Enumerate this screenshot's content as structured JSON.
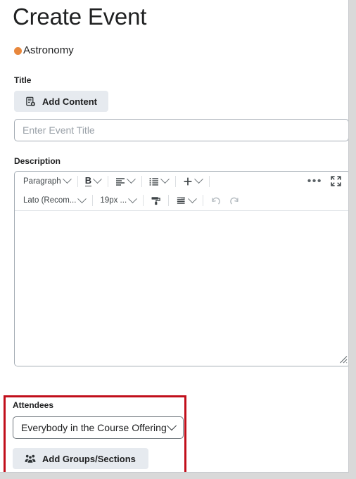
{
  "page": {
    "title": "Create Event"
  },
  "course": {
    "name": "Astronomy",
    "dot_color": "#e8873c",
    "dot_icon": "course-color-dot"
  },
  "title_field": {
    "label": "Title",
    "add_content_label": "Add Content",
    "add_content_icon": "add-content-icon",
    "input_value": "",
    "input_placeholder": "Enter Event Title"
  },
  "description_field": {
    "label": "Description",
    "editor": {
      "body_text": "",
      "toolbar_row1": [
        {
          "label": "Paragraph",
          "icon": "paragraph-style-select",
          "type": "dropdown"
        },
        {
          "label": "B",
          "icon": "bold-icon",
          "type": "dropdown-icon"
        },
        {
          "label": "",
          "icon": "align-left-icon",
          "type": "dropdown-icon"
        },
        {
          "label": "",
          "icon": "bullet-list-icon",
          "type": "dropdown-icon"
        },
        {
          "label": "+",
          "icon": "insert-plus-icon",
          "type": "dropdown-icon"
        },
        {
          "label": "",
          "icon": "more-options-icon",
          "type": "button"
        },
        {
          "label": "",
          "icon": "fullscreen-expand-icon",
          "type": "button"
        }
      ],
      "toolbar_row2": [
        {
          "label": "Lato (Recom...",
          "icon": "font-family-select",
          "type": "dropdown"
        },
        {
          "label": "19px ...",
          "icon": "font-size-select",
          "type": "dropdown"
        },
        {
          "label": "",
          "icon": "format-painter-icon",
          "type": "button"
        },
        {
          "label": "",
          "icon": "line-spacing-icon",
          "type": "dropdown-icon"
        },
        {
          "label": "",
          "icon": "undo-icon",
          "type": "button"
        },
        {
          "label": "",
          "icon": "redo-icon",
          "type": "button"
        }
      ],
      "resize_handle_icon": "resize-handle-icon"
    }
  },
  "attendees": {
    "label": "Attendees",
    "highlight_color": "#c10f1b",
    "select_value": "Everybody in the Course Offering",
    "select_chevron_icon": "chevron-down-icon",
    "add_groups_label": "Add Groups/Sections",
    "add_groups_icon": "people-group-icon"
  }
}
